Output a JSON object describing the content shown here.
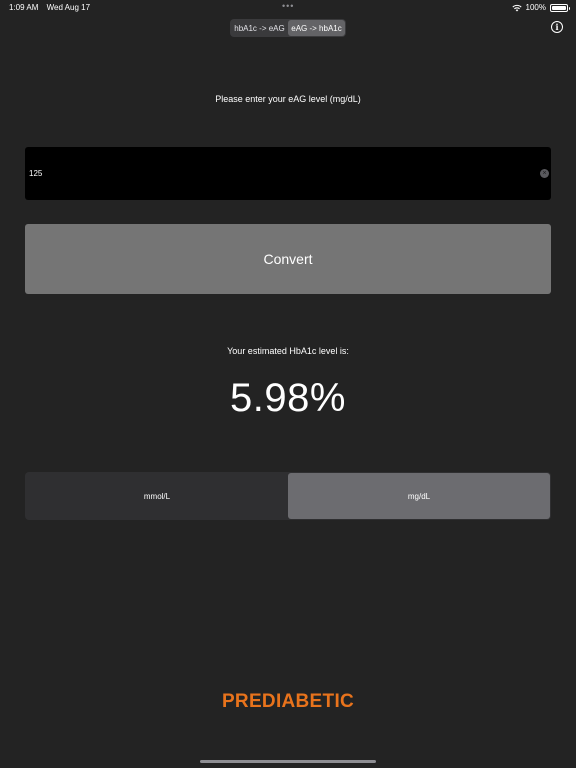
{
  "status_bar": {
    "time": "1:09 AM",
    "date": "Wed Aug 17",
    "dots": "•••",
    "battery_percent": "100%"
  },
  "mode_segment": {
    "options": [
      "hbA1c -> eAG",
      "eAG -> hbA1c"
    ],
    "selected_index": 1
  },
  "info_button": {
    "icon": "info-icon",
    "glyph": "i"
  },
  "input": {
    "label": "Please enter your eAG level (mg/dL)",
    "value": "125",
    "clear_icon": "clear-circle-icon"
  },
  "convert_button": {
    "label": "Convert"
  },
  "result": {
    "label": "Your estimated HbA1c level is:",
    "value": "5.98%"
  },
  "unit_segment": {
    "options": [
      "mmol/L",
      "mg/dL"
    ],
    "selected_index": 1
  },
  "classification": {
    "text": "PREDIABETIC",
    "color": "#e8731c"
  },
  "colors": {
    "background": "#232323",
    "input_background": "#000000",
    "button_background": "#757575",
    "segment_active": "#636366"
  }
}
